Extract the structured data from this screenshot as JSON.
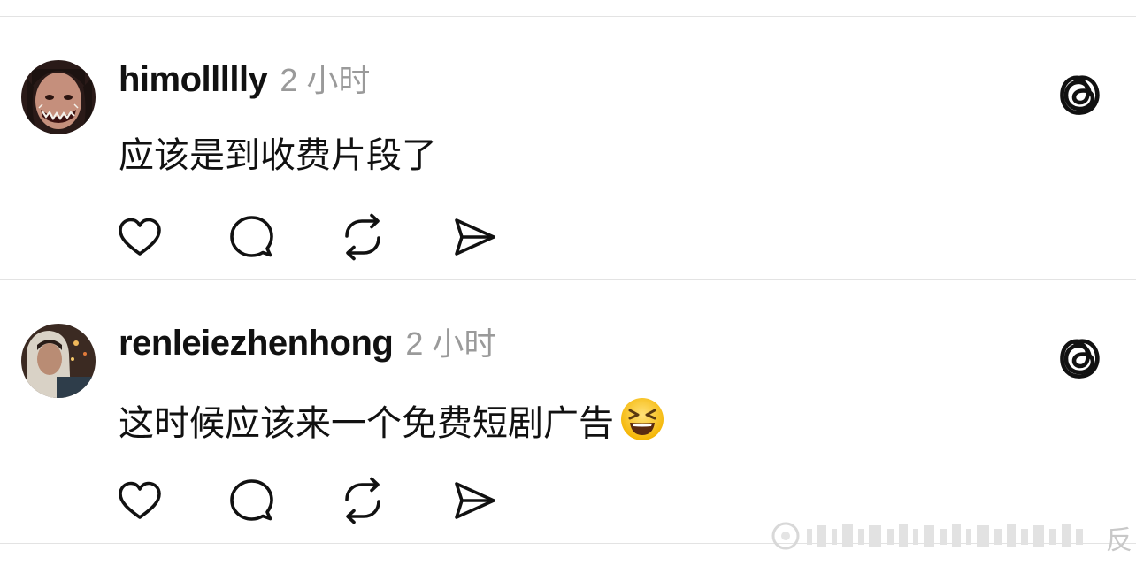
{
  "posts": [
    {
      "username": "himollllly",
      "time": "2 小时",
      "text": "应该是到收费片段了",
      "avatar_icon": "avatar-face-paint",
      "has_emoji": false
    },
    {
      "username": "renleiezhenhong",
      "time": "2 小时",
      "text": "这时候应该来一个免费短剧广告",
      "avatar_icon": "avatar-hoodie-night",
      "has_emoji": true,
      "emoji_icon": "laughing-face-emoji"
    }
  ],
  "actions": [
    "like-icon",
    "reply-icon",
    "repost-icon",
    "share-icon"
  ],
  "watermark_char": "反",
  "colors": {
    "text": "#111111",
    "muted": "#9a9a9a",
    "divider": "#e3e3e3",
    "icon": "#111111"
  }
}
